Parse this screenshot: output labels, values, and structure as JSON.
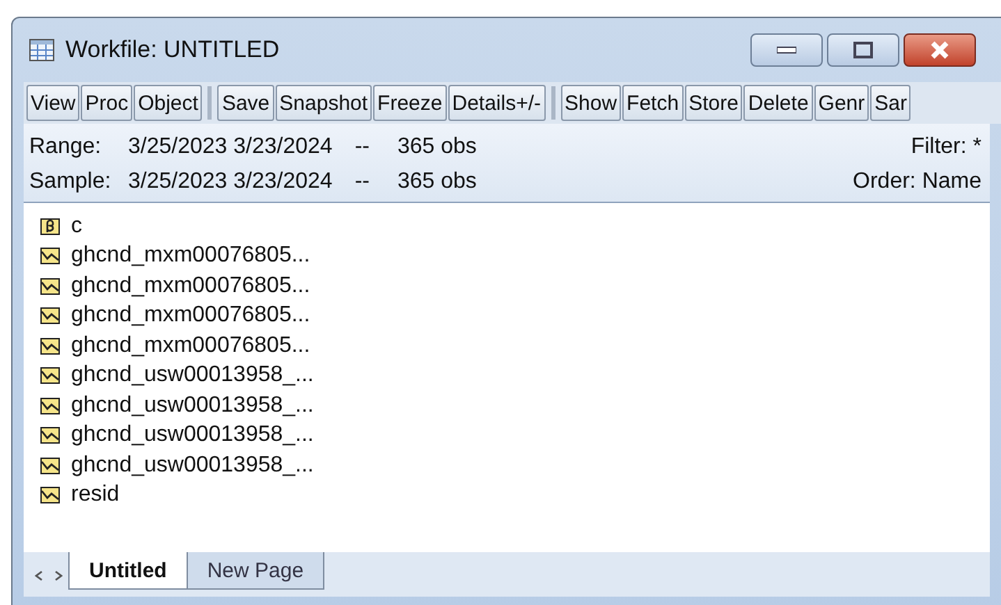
{
  "window": {
    "title": "Workfile: UNTITLED"
  },
  "toolbar": [
    [
      "View",
      "Proc",
      "Object"
    ],
    [
      "Save",
      "Snapshot",
      "Freeze",
      "Details+/-"
    ],
    [
      "Show",
      "Fetch",
      "Store",
      "Delete",
      "Genr",
      "Sar"
    ]
  ],
  "info": {
    "range_label": "Range:",
    "range": "3/25/2023 3/23/2024",
    "range_sep": "--",
    "range_obs": "365 obs",
    "filter": "Filter: *",
    "sample_label": "Sample:",
    "sample": "3/25/2023 3/23/2024",
    "sample_sep": "--",
    "sample_obs": "365 obs",
    "order": "Order: Name"
  },
  "objects": [
    {
      "kind": "coef",
      "name": "c"
    },
    {
      "kind": "series",
      "name": "ghcnd_mxm00076805..."
    },
    {
      "kind": "series",
      "name": "ghcnd_mxm00076805..."
    },
    {
      "kind": "series",
      "name": "ghcnd_mxm00076805..."
    },
    {
      "kind": "series",
      "name": "ghcnd_mxm00076805..."
    },
    {
      "kind": "series",
      "name": "ghcnd_usw00013958_..."
    },
    {
      "kind": "series",
      "name": "ghcnd_usw00013958_..."
    },
    {
      "kind": "series",
      "name": "ghcnd_usw00013958_..."
    },
    {
      "kind": "series",
      "name": "ghcnd_usw00013958_..."
    },
    {
      "kind": "series",
      "name": "resid"
    }
  ],
  "page_tabs": [
    {
      "label": "Untitled",
      "selected": true
    },
    {
      "label": "New Page",
      "selected": false
    }
  ]
}
